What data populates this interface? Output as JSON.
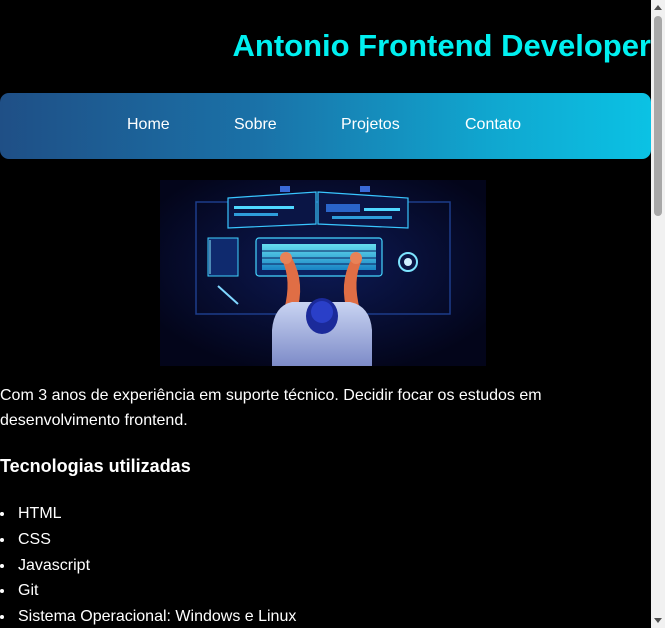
{
  "header": {
    "title": "Antonio Frontend Developer"
  },
  "nav": {
    "items": [
      {
        "label": "Home"
      },
      {
        "label": "Sobre"
      },
      {
        "label": "Projetos"
      },
      {
        "label": "Contato"
      }
    ]
  },
  "hero": {
    "icon": "developer-at-desk-illustration"
  },
  "intro": {
    "text": "Com 3 anos de experiência em suporte técnico. Decidir focar os estudos em desenvolvimento frontend."
  },
  "technologies": {
    "heading": "Tecnologias utilizadas",
    "items": [
      "HTML",
      "CSS",
      "Javascript",
      "Git",
      "Sistema Operacional: Windows e Linux"
    ]
  },
  "colors": {
    "title": "#00f0f0",
    "background": "#000000",
    "nav_gradient_start": "#1f4f86",
    "nav_gradient_end": "#0bc2e4"
  }
}
